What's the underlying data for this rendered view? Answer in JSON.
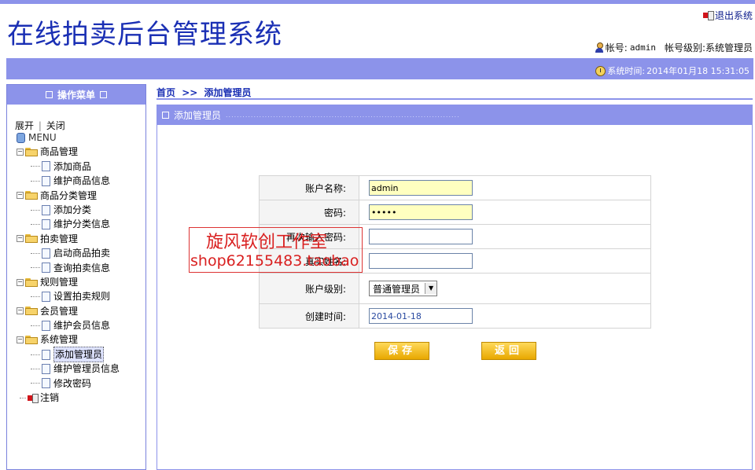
{
  "header": {
    "title": "在线拍卖后台管理系统",
    "logout_label": "退出系统",
    "account_prefix": "帐号:",
    "account_value": "admin",
    "level_text": "帐号级别:系统管理员",
    "time_prefix": "系统时间:",
    "time_value": "2014年01月18 15:31:05"
  },
  "sidebar": {
    "title": "操作菜单",
    "expand_label": "展开",
    "separator": "|",
    "collapse_label": "关闭",
    "root_label": "MENU",
    "groups": [
      {
        "label": "商品管理",
        "items": [
          "添加商品",
          "维护商品信息"
        ]
      },
      {
        "label": "商品分类管理",
        "items": [
          "添加分类",
          "维护分类信息"
        ]
      },
      {
        "label": "拍卖管理",
        "items": [
          "启动商品拍卖",
          "查询拍卖信息"
        ]
      },
      {
        "label": "规则管理",
        "items": [
          "设置拍卖规则"
        ]
      },
      {
        "label": "会员管理",
        "items": [
          "维护会员信息"
        ]
      },
      {
        "label": "系统管理",
        "items": [
          "添加管理员",
          "维护管理员信息",
          "修改密码"
        ]
      }
    ],
    "logout_item": "注销"
  },
  "breadcrumb": {
    "home": "首页",
    "sep": ">>",
    "current": "添加管理员"
  },
  "panel": {
    "title": "添加管理员",
    "dots": "...................................................................................."
  },
  "form": {
    "username_label": "账户名称:",
    "username_value": "admin",
    "password_label": "密码:",
    "password_value": "•••••",
    "confirm_label": "再次输入密码:",
    "confirm_value": "",
    "realname_label": "真实姓名:",
    "realname_value": "",
    "level_label": "账户级别:",
    "level_value": "普通管理员",
    "created_label": "创建时间:",
    "created_value": "2014-01-18"
  },
  "buttons": {
    "save": "保存",
    "back": "返回"
  },
  "watermark": {
    "line1": "旋风软创工作室",
    "line2": "shop62155483.taobao"
  },
  "colors": {
    "accent": "#8c93ea",
    "title": "#1a2fb4",
    "button": "#f2c230"
  }
}
